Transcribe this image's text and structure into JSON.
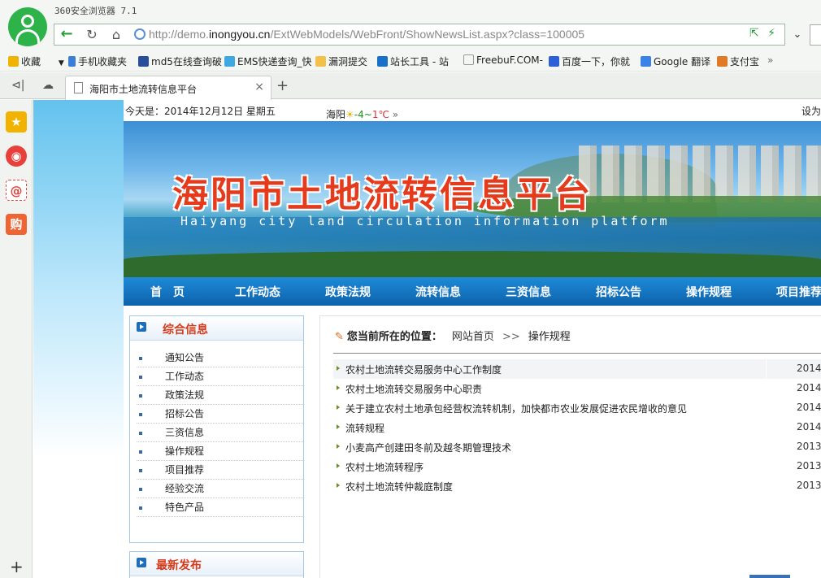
{
  "browser": {
    "app_title": "360安全浏览器 7.1",
    "url_prefix": "http://demo.",
    "url_domain": "inongyou.cn",
    "url_path": "/ExtWebModels/WebFront/ShowNewsList.aspx?class=100005",
    "bookmarks": [
      {
        "label": "收藏",
        "icon": "star-icon"
      },
      {
        "label": "手机收藏夹",
        "icon": "phone-icon"
      },
      {
        "label": "md5在线查询破",
        "icon": "grid-icon"
      },
      {
        "label": "EMS快递查询_快",
        "icon": "ems-icon"
      },
      {
        "label": "漏洞提交",
        "icon": "folder-icon"
      },
      {
        "label": "站长工具 - 站",
        "icon": "tool-icon"
      },
      {
        "label": "FreebuF.COM-",
        "icon": "freebuf-icon"
      },
      {
        "label": "百度一下，你就",
        "icon": "baidu-icon"
      },
      {
        "label": "Google 翻译",
        "icon": "translate-icon"
      },
      {
        "label": "支付宝",
        "icon": "alipay-icon"
      }
    ],
    "tab_label": "海阳市土地流转信息平台"
  },
  "site": {
    "date_text": "今天是：2014年12月12日 星期五",
    "weather_city": "海阳",
    "weather_low": "-4",
    "weather_sep": "~",
    "weather_high": "1℃",
    "setting_text": "设为",
    "banner_title": "海阳市土地流转信息平台",
    "banner_subtitle": "Haiyang city land circulation information platform",
    "nav": [
      "首　页",
      "工作动态",
      "政策法规",
      "流转信息",
      "三资信息",
      "招标公告",
      "操作规程",
      "项目推荐"
    ],
    "sidebar_title": "综合信息",
    "sidebar_items": [
      "通知公告",
      "工作动态",
      "政策法规",
      "招标公告",
      "三资信息",
      "操作规程",
      "项目推荐",
      "经验交流",
      "特色产品"
    ],
    "sidebar2_title": "最新发布",
    "breadcrumb_label": "您当前所在的位置：",
    "breadcrumb_home": "网站首页",
    "breadcrumb_sep": ">>",
    "breadcrumb_current": "操作规程",
    "news": [
      {
        "title": "农村土地流转交易服务中心工作制度",
        "date": "2014-"
      },
      {
        "title": "农村土地流转交易服务中心职责",
        "date": "2014-"
      },
      {
        "title": "关于建立农村土地承包经营权流转机制，加快都市农业发展促进农民增收的意见",
        "date": "2014-"
      },
      {
        "title": "流转规程",
        "date": "2014-"
      },
      {
        "title": "小麦高产创建田冬前及越冬期管理技术",
        "date": "2013-"
      },
      {
        "title": "农村土地流转程序",
        "date": "2013-"
      },
      {
        "title": "农村土地流转仲裁庭制度",
        "date": "2013-"
      }
    ]
  },
  "colors": {
    "accent_green": "#2db34a",
    "nav_blue": "#0d62ab",
    "title_red": "#e53a1b"
  }
}
